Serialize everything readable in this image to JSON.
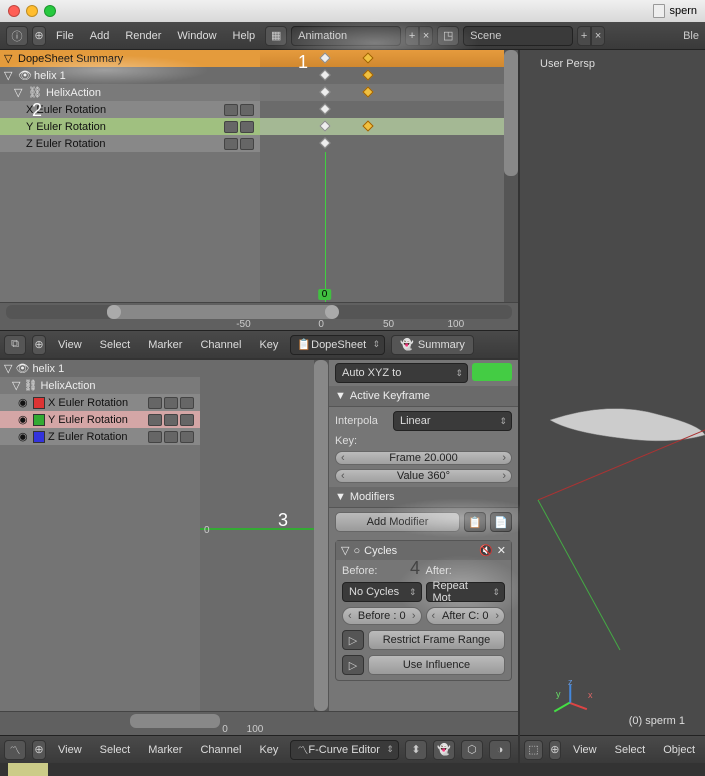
{
  "titlebar": {
    "doc_hint": "spern"
  },
  "header": {
    "menus": [
      "File",
      "Add",
      "Render",
      "Window",
      "Help"
    ],
    "layout_label": "Animation",
    "scene_label": "Scene",
    "right_label": "Ble"
  },
  "dope": {
    "summary_label": "DopeSheet Summary",
    "object_label": "helix 1",
    "action_label": "HelixAction",
    "channels": [
      "X Euler Rotation",
      "Y Euler Rotation",
      "Z Euler Rotation"
    ],
    "frame_current": "0",
    "ticks": [
      "-50",
      "0",
      "50",
      "100"
    ],
    "menu": [
      "View",
      "Select",
      "Marker",
      "Channel",
      "Key"
    ],
    "mode": "DopeSheet",
    "summary_btn": "Summary"
  },
  "graph": {
    "object_label": "helix 1",
    "action_label": "HelixAction",
    "channels": [
      "X Euler Rotation",
      "Y Euler Rotation",
      "Z Euler Rotation"
    ],
    "props": {
      "auto_btn": "Auto XYZ to",
      "active_kf": "Active Keyframe",
      "interp_label": "Interpola",
      "interp_value": "Linear",
      "key_label": "Key:",
      "key_frame": "Frame 20.000",
      "key_value": "Value 360°",
      "modifiers_header": "Modifiers",
      "add_modifier": "Add Modifier",
      "mod_name": "Cycles",
      "before_label": "Before:",
      "after_label": "After:",
      "before_mode": "No Cycles",
      "after_mode": "Repeat Mot",
      "before_count": "Before : 0",
      "after_count": "After C: 0",
      "restrict": "Restrict Frame Range",
      "influence": "Use Influence"
    },
    "menu": [
      "View",
      "Select",
      "Marker",
      "Channel",
      "Key"
    ],
    "mode": "F-Curve Editor",
    "ruler_ticks": [
      "0",
      "100"
    ]
  },
  "viewport": {
    "persp": "User Persp",
    "scene_name": "(0) sperm 1",
    "menu": [
      "View",
      "Select",
      "Object"
    ]
  },
  "annotations": {
    "n1": "1",
    "n2": "2",
    "n3": "3",
    "n4": "4"
  }
}
